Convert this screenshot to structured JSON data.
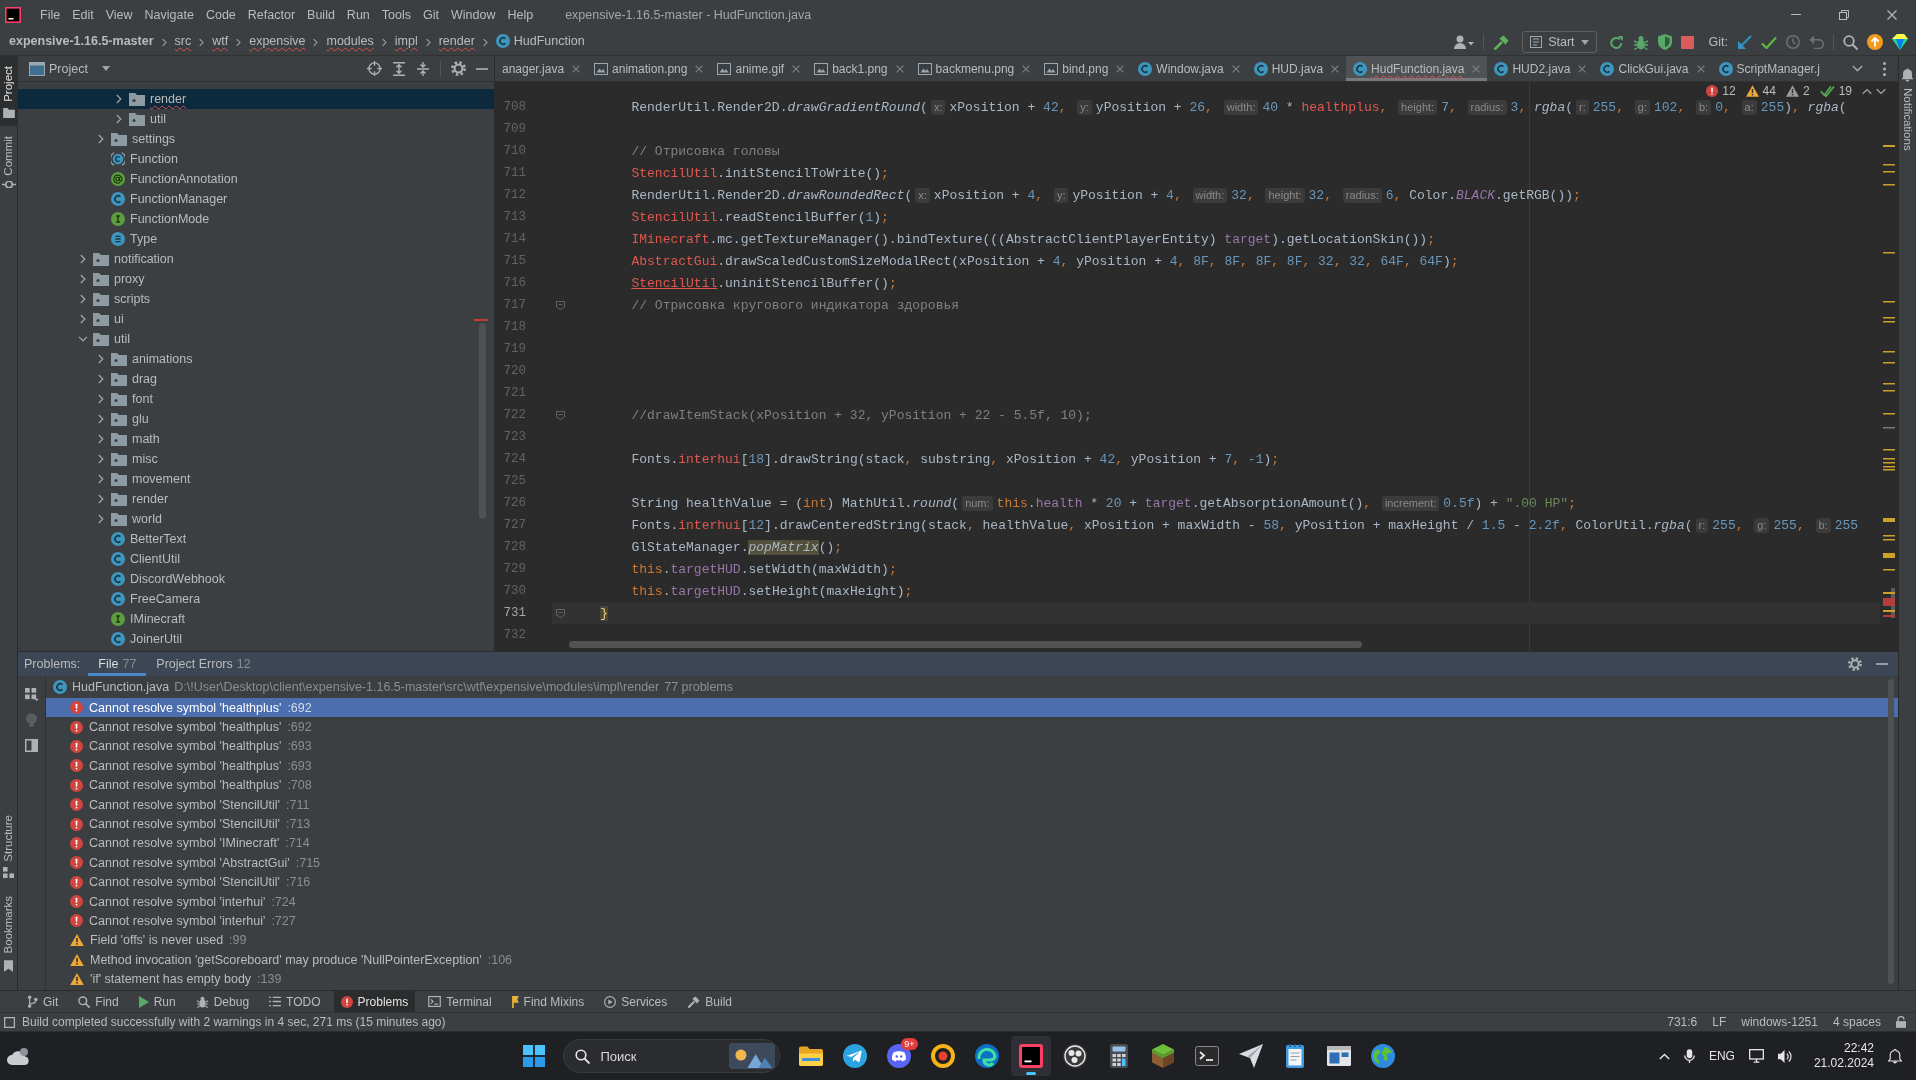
{
  "title_bar": {
    "menus": [
      "File",
      "Edit",
      "View",
      "Navigate",
      "Code",
      "Refactor",
      "Build",
      "Run",
      "Tools",
      "Git",
      "Window",
      "Help"
    ],
    "title": "expensive-1.16.5-master - HudFunction.java"
  },
  "nav_bar": {
    "breadcrumbs": [
      {
        "label": "expensive-1.16.5-master",
        "kind": "project",
        "error": false
      },
      {
        "label": "src",
        "kind": "folder",
        "error": true
      },
      {
        "label": "wtf",
        "kind": "folder",
        "error": true
      },
      {
        "label": "expensive",
        "kind": "folder",
        "error": true
      },
      {
        "label": "modules",
        "kind": "folder",
        "error": true
      },
      {
        "label": "impl",
        "kind": "folder",
        "error": true
      },
      {
        "label": "render",
        "kind": "folder",
        "error": true
      },
      {
        "label": "HudFunction",
        "kind": "class",
        "error": false
      }
    ],
    "run_config": "Start",
    "vcs_label": "Git:"
  },
  "side_tabs": {
    "top": [
      {
        "label": "Project",
        "kind": "project",
        "selected": true
      },
      {
        "label": "Commit",
        "kind": "commit",
        "selected": false
      }
    ],
    "bottom": [
      {
        "label": "Structure",
        "kind": "structure",
        "selected": false
      },
      {
        "label": "Bookmarks",
        "kind": "bookmarks",
        "selected": false
      }
    ]
  },
  "project_panel": {
    "title": "Project",
    "tree": [
      {
        "children": [
          {
            "children": [
              {
                "label": "render",
                "kind": "folder",
                "expanded": false,
                "selected": true,
                "error": true
              },
              {
                "label": "util",
                "kind": "folder",
                "expanded": false,
                "selected": false,
                "error": false
              }
            ]
          },
          {
            "label": "settings",
            "kind": "folder",
            "expanded": false,
            "selected": false,
            "error": false
          },
          {
            "label": "Function",
            "kind": "abstract",
            "selected": false,
            "error": false
          },
          {
            "label": "FunctionAnnotation",
            "kind": "annotation",
            "selected": false,
            "error": false
          },
          {
            "label": "FunctionManager",
            "kind": "class",
            "selected": false,
            "error": false
          },
          {
            "label": "FunctionMode",
            "kind": "interface",
            "selected": false,
            "error": false
          },
          {
            "label": "Type",
            "kind": "enum",
            "selected": false,
            "error": false
          }
        ]
      },
      {
        "label": "notification",
        "kind": "folder",
        "expanded": false,
        "selected": false,
        "error": false
      },
      {
        "label": "proxy",
        "kind": "folder",
        "expanded": false,
        "selected": false,
        "error": false
      },
      {
        "label": "scripts",
        "kind": "folder",
        "expanded": false,
        "selected": false,
        "error": false
      },
      {
        "label": "ui",
        "kind": "folder",
        "expanded": false,
        "selected": false,
        "error": false
      },
      {
        "label": "util",
        "kind": "folder",
        "expanded": true,
        "selected": false,
        "error": false,
        "children": [
          {
            "label": "animations",
            "kind": "folder",
            "expanded": false,
            "selected": false,
            "error": false
          },
          {
            "label": "drag",
            "kind": "folder",
            "expanded": false,
            "selected": false,
            "error": false
          },
          {
            "label": "font",
            "kind": "folder",
            "expanded": false,
            "selected": false,
            "error": false
          },
          {
            "label": "glu",
            "kind": "folder",
            "expanded": false,
            "selected": false,
            "error": false
          },
          {
            "label": "math",
            "kind": "folder",
            "expanded": false,
            "selected": false,
            "error": false
          },
          {
            "label": "misc",
            "kind": "folder",
            "expanded": false,
            "selected": false,
            "error": false
          },
          {
            "label": "movement",
            "kind": "folder",
            "expanded": false,
            "selected": false,
            "error": false
          },
          {
            "label": "render",
            "kind": "folder",
            "expanded": false,
            "selected": false,
            "error": false
          },
          {
            "label": "world",
            "kind": "folder",
            "expanded": false,
            "selected": false,
            "error": false
          },
          {
            "label": "BetterText",
            "kind": "class",
            "selected": false,
            "error": false
          },
          {
            "label": "ClientUtil",
            "kind": "class",
            "selected": false,
            "error": false
          },
          {
            "label": "DiscordWebhook",
            "kind": "class",
            "selected": false,
            "error": false
          },
          {
            "label": "FreeCamera",
            "kind": "class",
            "selected": false,
            "error": false
          },
          {
            "label": "IMinecraft",
            "kind": "interface",
            "selected": false,
            "error": false
          },
          {
            "label": "JoinerUtil",
            "kind": "class",
            "selected": false,
            "error": false
          }
        ]
      }
    ]
  },
  "editor": {
    "tabs": [
      {
        "label": "anager.java",
        "kind": "cut",
        "selected": false,
        "error": false,
        "closable": true
      },
      {
        "label": "animation.png",
        "kind": "image",
        "selected": false,
        "error": false,
        "closable": true
      },
      {
        "label": "anime.gif",
        "kind": "image",
        "selected": false,
        "error": false,
        "closable": true
      },
      {
        "label": "back1.png",
        "kind": "image",
        "selected": false,
        "error": false,
        "closable": true
      },
      {
        "label": "backmenu.png",
        "kind": "image",
        "selected": false,
        "error": false,
        "closable": true
      },
      {
        "label": "bind.png",
        "kind": "image",
        "selected": false,
        "error": false,
        "closable": true
      },
      {
        "label": "Window.java",
        "kind": "java",
        "selected": false,
        "error": false,
        "closable": true
      },
      {
        "label": "HUD.java",
        "kind": "java",
        "selected": false,
        "error": false,
        "closable": true
      },
      {
        "label": "HudFunction.java",
        "kind": "java",
        "selected": true,
        "error": true,
        "closable": true
      },
      {
        "label": "HUD2.java",
        "kind": "java",
        "selected": false,
        "error": false,
        "closable": true
      },
      {
        "label": "ClickGui.java",
        "kind": "java",
        "selected": false,
        "error": false,
        "closable": true
      },
      {
        "label": "ScriptManager.j",
        "kind": "java",
        "selected": false,
        "error": false,
        "closable": false
      }
    ],
    "inspection": {
      "errors": "12",
      "warnings": "44",
      "weak_warnings": "2",
      "passed": "19"
    },
    "lines": [
      {
        "number": "708",
        "current": false,
        "fold": false,
        "tokens": [
          {
            "kind": "plain",
            "text": "        RenderUtil.Render2D."
          },
          {
            "kind": "italic",
            "text": "drawGradientRound"
          },
          {
            "kind": "plain",
            "text": "("
          },
          {
            "kind": "hint",
            "text": "x:"
          },
          {
            "kind": "plain",
            "text": "xPosition + "
          },
          {
            "kind": "num",
            "text": "42"
          },
          {
            "kind": "kw",
            "text": ", "
          },
          {
            "kind": "hint",
            "text": "y:"
          },
          {
            "kind": "plain",
            "text": "yPosition + "
          },
          {
            "kind": "num",
            "text": "26"
          },
          {
            "kind": "kw",
            "text": ", "
          },
          {
            "kind": "hint",
            "text": "width:"
          },
          {
            "kind": "num",
            "text": "40"
          },
          {
            "kind": "plain",
            "text": " * "
          },
          {
            "kind": "error",
            "text": "healthplus"
          },
          {
            "kind": "kw",
            "text": ", "
          },
          {
            "kind": "hint",
            "text": "height:"
          },
          {
            "kind": "num",
            "text": "7"
          },
          {
            "kind": "kw",
            "text": ", "
          },
          {
            "kind": "hint",
            "text": "radius:"
          },
          {
            "kind": "num",
            "text": "3"
          },
          {
            "kind": "kw",
            "text": ", "
          },
          {
            "kind": "italic",
            "text": "rgba"
          },
          {
            "kind": "plain",
            "text": "("
          },
          {
            "kind": "hint",
            "text": "r:"
          },
          {
            "kind": "num",
            "text": "255"
          },
          {
            "kind": "kw",
            "text": ", "
          },
          {
            "kind": "hint",
            "text": "g:"
          },
          {
            "kind": "num",
            "text": "102"
          },
          {
            "kind": "kw",
            "text": ", "
          },
          {
            "kind": "hint",
            "text": "b:"
          },
          {
            "kind": "num",
            "text": "0"
          },
          {
            "kind": "kw",
            "text": ", "
          },
          {
            "kind": "hint",
            "text": "a:"
          },
          {
            "kind": "num",
            "text": "255"
          },
          {
            "kind": "plain",
            "text": ")"
          },
          {
            "kind": "kw",
            "text": ", "
          },
          {
            "kind": "italic",
            "text": "rgba"
          },
          {
            "kind": "plain",
            "text": "("
          }
        ]
      },
      {
        "number": "709",
        "current": false,
        "fold": false
      },
      {
        "number": "710",
        "current": false,
        "fold": false,
        "tokens": [
          {
            "kind": "comment",
            "text": "        // Отрисовка головы"
          }
        ]
      },
      {
        "number": "711",
        "current": false,
        "fold": false,
        "tokens": [
          {
            "kind": "error",
            "text": "        StencilUtil"
          },
          {
            "kind": "plain",
            "text": ".initStencilToWrite()"
          },
          {
            "kind": "kw",
            "text": ";"
          }
        ]
      },
      {
        "number": "712",
        "current": false,
        "fold": false,
        "tokens": [
          {
            "kind": "plain",
            "text": "        RenderUtil.Render2D."
          },
          {
            "kind": "italic",
            "text": "drawRoundedRect"
          },
          {
            "kind": "plain",
            "text": "("
          },
          {
            "kind": "hint",
            "text": "x:"
          },
          {
            "kind": "plain",
            "text": "xPosition + "
          },
          {
            "kind": "num",
            "text": "4"
          },
          {
            "kind": "kw",
            "text": ", "
          },
          {
            "kind": "hint",
            "text": "y:"
          },
          {
            "kind": "plain",
            "text": "yPosition + "
          },
          {
            "kind": "num",
            "text": "4"
          },
          {
            "kind": "kw",
            "text": ", "
          },
          {
            "kind": "hint",
            "text": "width:"
          },
          {
            "kind": "num",
            "text": "32"
          },
          {
            "kind": "kw",
            "text": ", "
          },
          {
            "kind": "hint",
            "text": "height:"
          },
          {
            "kind": "num",
            "text": "32"
          },
          {
            "kind": "kw",
            "text": ", "
          },
          {
            "kind": "hint",
            "text": "radius:"
          },
          {
            "kind": "num",
            "text": "6"
          },
          {
            "kind": "kw",
            "text": ", "
          },
          {
            "kind": "plain",
            "text": "Color."
          },
          {
            "kind": "const",
            "text": "BLACK"
          },
          {
            "kind": "plain",
            "text": ".getRGB())"
          },
          {
            "kind": "kw",
            "text": ";"
          }
        ]
      },
      {
        "number": "713",
        "current": false,
        "fold": false,
        "tokens": [
          {
            "kind": "error",
            "text": "        StencilUtil"
          },
          {
            "kind": "plain",
            "text": ".readStencilBuffer("
          },
          {
            "kind": "num",
            "text": "1"
          },
          {
            "kind": "plain",
            "text": ")"
          },
          {
            "kind": "kw",
            "text": ";"
          }
        ]
      },
      {
        "number": "714",
        "current": false,
        "fold": false,
        "tokens": [
          {
            "kind": "error",
            "text": "        IMinecraft"
          },
          {
            "kind": "plain",
            "text": ".mc.getTextureManager().bindTexture(((AbstractClientPlayerEntity) "
          },
          {
            "kind": "field",
            "text": "target"
          },
          {
            "kind": "plain",
            "text": ").getLocationSkin())"
          },
          {
            "kind": "kw",
            "text": ";"
          }
        ]
      },
      {
        "number": "715",
        "current": false,
        "fold": false,
        "tokens": [
          {
            "kind": "error",
            "text": "        AbstractGui"
          },
          {
            "kind": "plain",
            "text": ".drawScaledCustomSizeModalRect(xPosition + "
          },
          {
            "kind": "num",
            "text": "4"
          },
          {
            "kind": "kw",
            "text": ", "
          },
          {
            "kind": "plain",
            "text": "yPosition + "
          },
          {
            "kind": "num",
            "text": "4"
          },
          {
            "kind": "kw",
            "text": ", "
          },
          {
            "kind": "num",
            "text": "8F"
          },
          {
            "kind": "kw",
            "text": ", "
          },
          {
            "kind": "num",
            "text": "8F"
          },
          {
            "kind": "kw",
            "text": ", "
          },
          {
            "kind": "num",
            "text": "8F"
          },
          {
            "kind": "kw",
            "text": ", "
          },
          {
            "kind": "num",
            "text": "8F"
          },
          {
            "kind": "kw",
            "text": ", "
          },
          {
            "kind": "num",
            "text": "32"
          },
          {
            "kind": "kw",
            "text": ", "
          },
          {
            "kind": "num",
            "text": "32"
          },
          {
            "kind": "kw",
            "text": ", "
          },
          {
            "kind": "num",
            "text": "64F"
          },
          {
            "kind": "kw",
            "text": ", "
          },
          {
            "kind": "num",
            "text": "64F"
          },
          {
            "kind": "plain",
            "text": ")"
          },
          {
            "kind": "kw",
            "text": ";"
          }
        ]
      },
      {
        "number": "716",
        "current": false,
        "fold": false,
        "tokens": [
          {
            "kind": "error_ul",
            "text": "        StencilUtil"
          },
          {
            "kind": "plain",
            "text": ".uninitStencilBuffer()"
          },
          {
            "kind": "kw",
            "text": ";"
          }
        ]
      },
      {
        "number": "717",
        "current": false,
        "fold": true,
        "tokens": [
          {
            "kind": "comment",
            "text": "        // Отрисовка кругового индикатора здоровья"
          }
        ]
      },
      {
        "number": "718",
        "current": false,
        "fold": false
      },
      {
        "number": "719",
        "current": false,
        "fold": false
      },
      {
        "number": "720",
        "current": false,
        "fold": false
      },
      {
        "number": "721",
        "current": false,
        "fold": false
      },
      {
        "number": "722",
        "current": false,
        "fold": true,
        "tokens": [
          {
            "kind": "comment",
            "text": "        //drawItemStack(xPosition + 32, yPosition + 22 - 5.5f, 10);"
          }
        ]
      },
      {
        "number": "723",
        "current": false,
        "fold": false
      },
      {
        "number": "724",
        "current": false,
        "fold": false,
        "tokens": [
          {
            "kind": "plain",
            "text": "        Fonts."
          },
          {
            "kind": "error",
            "text": "interhui"
          },
          {
            "kind": "plain",
            "text": "["
          },
          {
            "kind": "num",
            "text": "18"
          },
          {
            "kind": "plain",
            "text": "].drawString(stack"
          },
          {
            "kind": "kw",
            "text": ", "
          },
          {
            "kind": "plain",
            "text": "substring"
          },
          {
            "kind": "kw",
            "text": ", "
          },
          {
            "kind": "plain",
            "text": "xPosition + "
          },
          {
            "kind": "num",
            "text": "42"
          },
          {
            "kind": "kw",
            "text": ", "
          },
          {
            "kind": "plain",
            "text": "yPosition + "
          },
          {
            "kind": "num",
            "text": "7"
          },
          {
            "kind": "kw",
            "text": ", "
          },
          {
            "kind": "num",
            "text": "-1"
          },
          {
            "kind": "plain",
            "text": ")"
          },
          {
            "kind": "kw",
            "text": ";"
          }
        ]
      },
      {
        "number": "725",
        "current": false,
        "fold": false
      },
      {
        "number": "726",
        "current": false,
        "fold": false,
        "tokens": [
          {
            "kind": "plain",
            "text": "        String healthValue = ("
          },
          {
            "kind": "kw",
            "text": "int"
          },
          {
            "kind": "plain",
            "text": ") MathUtil."
          },
          {
            "kind": "italic",
            "text": "round"
          },
          {
            "kind": "plain",
            "text": "("
          },
          {
            "kind": "hint",
            "text": "num:"
          },
          {
            "kind": "kw",
            "text": "this"
          },
          {
            "kind": "plain",
            "text": "."
          },
          {
            "kind": "field",
            "text": "health"
          },
          {
            "kind": "plain",
            "text": " * "
          },
          {
            "kind": "num",
            "text": "20"
          },
          {
            "kind": "plain",
            "text": " + "
          },
          {
            "kind": "field",
            "text": "target"
          },
          {
            "kind": "plain",
            "text": ".getAbsorptionAmount()"
          },
          {
            "kind": "kw",
            "text": ", "
          },
          {
            "kind": "hint",
            "text": "increment:"
          },
          {
            "kind": "num",
            "text": "0.5f"
          },
          {
            "kind": "plain",
            "text": ") + "
          },
          {
            "kind": "str",
            "text": "\".00 HP\""
          },
          {
            "kind": "kw",
            "text": ";"
          }
        ]
      },
      {
        "number": "727",
        "current": false,
        "fold": false,
        "tokens": [
          {
            "kind": "plain",
            "text": "        Fonts."
          },
          {
            "kind": "error",
            "text": "interhui"
          },
          {
            "kind": "plain",
            "text": "["
          },
          {
            "kind": "num",
            "text": "12"
          },
          {
            "kind": "plain",
            "text": "].drawCenteredString(stack"
          },
          {
            "kind": "kw",
            "text": ", "
          },
          {
            "kind": "plain",
            "text": "healthValue"
          },
          {
            "kind": "kw",
            "text": ", "
          },
          {
            "kind": "plain",
            "text": "xPosition + maxWidth - "
          },
          {
            "kind": "num",
            "text": "58"
          },
          {
            "kind": "kw",
            "text": ", "
          },
          {
            "kind": "plain",
            "text": "yPosition + maxHeight / "
          },
          {
            "kind": "num",
            "text": "1.5"
          },
          {
            "kind": "plain",
            "text": " - "
          },
          {
            "kind": "num",
            "text": "2.2f"
          },
          {
            "kind": "kw",
            "text": ", "
          },
          {
            "kind": "plain",
            "text": "ColorUtil."
          },
          {
            "kind": "italic",
            "text": "rgba"
          },
          {
            "kind": "plain",
            "text": "("
          },
          {
            "kind": "hint",
            "text": "r:"
          },
          {
            "kind": "num",
            "text": "255"
          },
          {
            "kind": "kw",
            "text": ", "
          },
          {
            "kind": "hint",
            "text": "g:"
          },
          {
            "kind": "num",
            "text": "255"
          },
          {
            "kind": "kw",
            "text": ", "
          },
          {
            "kind": "hint",
            "text": "b:"
          },
          {
            "kind": "num",
            "text": "255"
          }
        ]
      },
      {
        "number": "728",
        "current": false,
        "fold": false,
        "tokens": [
          {
            "kind": "plain",
            "text": "        GlStateManager."
          },
          {
            "kind": "deprecated",
            "text": "popMatrix"
          },
          {
            "kind": "plain",
            "text": "()"
          },
          {
            "kind": "kw",
            "text": ";"
          }
        ]
      },
      {
        "number": "729",
        "current": false,
        "fold": false,
        "tokens": [
          {
            "kind": "kw",
            "text": "        this"
          },
          {
            "kind": "plain",
            "text": "."
          },
          {
            "kind": "field",
            "text": "targetHUD"
          },
          {
            "kind": "plain",
            "text": ".setWidth(maxWidth)"
          },
          {
            "kind": "kw",
            "text": ";"
          }
        ]
      },
      {
        "number": "730",
        "current": false,
        "fold": false,
        "tokens": [
          {
            "kind": "kw",
            "text": "        this"
          },
          {
            "kind": "plain",
            "text": "."
          },
          {
            "kind": "field",
            "text": "targetHUD"
          },
          {
            "kind": "plain",
            "text": ".setHeight(maxHeight)"
          },
          {
            "kind": "kw",
            "text": ";"
          }
        ]
      },
      {
        "number": "731",
        "current": true,
        "fold": true,
        "tokens": [
          {
            "kind": "brace",
            "text": "    }"
          }
        ]
      },
      {
        "number": "732",
        "current": false,
        "fold": false
      }
    ]
  },
  "notifications_strip": {
    "label": "Notifications"
  },
  "problems": {
    "label": "Problems:",
    "tabs": [
      {
        "label": "File",
        "count": "77",
        "selected": true
      },
      {
        "label": "Project Errors",
        "count": "12",
        "selected": false
      }
    ],
    "file": {
      "name": "HudFunction.java",
      "path": "D:\\!User\\Desktop\\client\\expensive-1.16.5-master\\src\\wtf\\expensive\\modules\\impl\\render",
      "count": "77 problems"
    },
    "items": [
      {
        "kind": "error",
        "message": "Cannot resolve symbol 'healthplus'",
        "line": ":692",
        "selected": true
      },
      {
        "kind": "error",
        "message": "Cannot resolve symbol 'healthplus'",
        "line": ":692",
        "selected": false
      },
      {
        "kind": "error",
        "message": "Cannot resolve symbol 'healthplus'",
        "line": ":693",
        "selected": false
      },
      {
        "kind": "error",
        "message": "Cannot resolve symbol 'healthplus'",
        "line": ":693",
        "selected": false
      },
      {
        "kind": "error",
        "message": "Cannot resolve symbol 'healthplus'",
        "line": ":708",
        "selected": false
      },
      {
        "kind": "error",
        "message": "Cannot resolve symbol 'StencilUtil'",
        "line": ":711",
        "selected": false
      },
      {
        "kind": "error",
        "message": "Cannot resolve symbol 'StencilUtil'",
        "line": ":713",
        "selected": false
      },
      {
        "kind": "error",
        "message": "Cannot resolve symbol 'IMinecraft'",
        "line": ":714",
        "selected": false
      },
      {
        "kind": "error",
        "message": "Cannot resolve symbol 'AbstractGui'",
        "line": ":715",
        "selected": false
      },
      {
        "kind": "error",
        "message": "Cannot resolve symbol 'StencilUtil'",
        "line": ":716",
        "selected": false
      },
      {
        "kind": "error",
        "message": "Cannot resolve symbol 'interhui'",
        "line": ":724",
        "selected": false
      },
      {
        "kind": "error",
        "message": "Cannot resolve symbol 'interhui'",
        "line": ":727",
        "selected": false
      },
      {
        "kind": "warning",
        "message": "Field 'offs' is never used",
        "line": ":99",
        "selected": false
      },
      {
        "kind": "warning",
        "message": "Method invocation 'getScoreboard' may produce 'NullPointerException'",
        "line": ":106",
        "selected": false
      },
      {
        "kind": "warning",
        "message": "'if' statement has empty body",
        "line": ":139",
        "selected": false
      }
    ]
  },
  "tool_windows": [
    {
      "label": "Git",
      "kind": "git",
      "selected": false
    },
    {
      "label": "Find",
      "kind": "find",
      "selected": false
    },
    {
      "label": "Run",
      "kind": "run",
      "selected": false
    },
    {
      "label": "Debug",
      "kind": "debug",
      "selected": false
    },
    {
      "label": "TODO",
      "kind": "todo",
      "selected": false
    },
    {
      "label": "Problems",
      "kind": "problems",
      "selected": true
    },
    {
      "label": "Terminal",
      "kind": "terminal",
      "selected": false
    },
    {
      "label": "Find Mixins",
      "kind": "mixins",
      "selected": false
    },
    {
      "label": "Services",
      "kind": "services",
      "selected": false
    },
    {
      "label": "Build",
      "kind": "build",
      "selected": false
    }
  ],
  "status_bar": {
    "message": "Build completed successfully with 2 warnings in 4 sec, 271 ms (15 minutes ago)",
    "position": "731:6",
    "line_separator": "LF",
    "encoding": "windows-1251",
    "indent": "4 spaces"
  },
  "taskbar": {
    "search": {
      "placeholder": "Поиск"
    },
    "apps": [
      {
        "kind": "folder",
        "active": false
      },
      {
        "kind": "plane",
        "active": false
      },
      {
        "kind": "controller",
        "active": false,
        "badge": "9+"
      },
      {
        "kind": "ring",
        "active": false
      },
      {
        "kind": "swirl",
        "active": false
      },
      {
        "kind": "ide",
        "active": true
      },
      {
        "kind": "aperture",
        "active": false
      },
      {
        "kind": "calculator",
        "active": false
      },
      {
        "kind": "block",
        "active": false
      },
      {
        "kind": "terminal",
        "active": false
      },
      {
        "kind": "glider",
        "active": false
      },
      {
        "kind": "notepad",
        "active": false
      },
      {
        "kind": "window",
        "active": false
      },
      {
        "kind": "globe",
        "active": false
      }
    ],
    "language": "ENG",
    "time": "22:42",
    "date": "21.02.2024"
  }
}
